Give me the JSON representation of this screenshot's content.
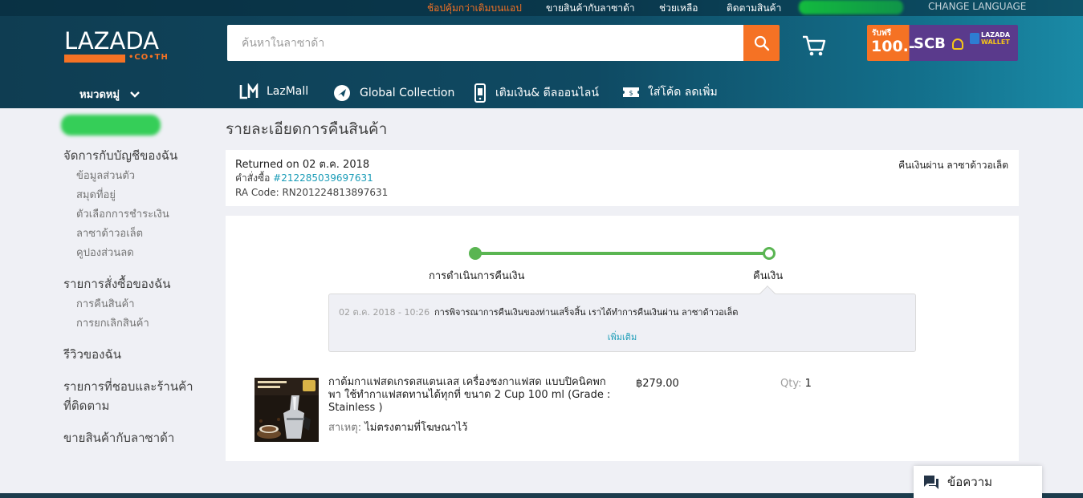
{
  "topbar": {
    "app_offer": "ช้อปคุ้มกว่าเดิมบนแอป",
    "sell": "ขายสินค้ากับลาซาด้า",
    "help": "ช่วยเหลือ",
    "track": "ติดตามสินค้า",
    "change_language": "CHANGE LANGUAGE"
  },
  "header": {
    "logo_word": "LAZADA",
    "logo_domain": "•CO•TH",
    "search_placeholder": "ค้นหาในลาซาด้า",
    "banner": {
      "line1": "รับฟรี",
      "amount": "100.-",
      "bank": "SCB",
      "wallet_line1": "LAZADA",
      "wallet_line2": "WALLET"
    }
  },
  "catnav": {
    "categories": "หมวดหมู่",
    "links": [
      "LazMall",
      "Global Collection",
      "เติมเงิน& ดีลออนไลน์",
      "ใส่โค้ด ลดเพิ่ม"
    ]
  },
  "sidebar": {
    "manage_account": "จัดการกับบัญชีของฉัน",
    "account_items": [
      "ข้อมูลส่วนตัว",
      "สมุดที่อยู่",
      "ตัวเลือกการชำระเงิน",
      "ลาซาด้าวอเล็ต",
      "คูปองส่วนลด"
    ],
    "my_orders": "รายการสั่งซื้อของฉัน",
    "order_items": [
      "การคืนสินค้า",
      "การยกเลิกสินค้า"
    ],
    "reviews": "รีวิวของฉัน",
    "wishlist_line1": "รายการที่ชอบและร้านค้า",
    "wishlist_line2": "ที่ติดตาม",
    "sell": "ขายสินค้ากับลาซาด้า"
  },
  "main": {
    "title": "รายละเอียดการคืนสินค้า",
    "returned_on": "Returned on 02 ต.ค. 2018",
    "order_label": "คำสั่งซื้อ",
    "order_number": "#212285039697631",
    "ra_code": "RA Code: RN201224813897631",
    "refund_via": "คืนเงินผ่าน ลาซาด้าวอเล็ต",
    "steps": [
      "การดำเนินการคืนเงิน",
      "คืนเงิน"
    ],
    "detail_time": "02 ต.ค. 2018 - 10:26",
    "detail_message": "การพิจารณาการคืนเงินของท่านเสร็จสิ้น เราได้ทำการคืนเงินผ่าน ลาซาด้าวอเล็ต",
    "more": "เพิ่มเติม",
    "product": {
      "name": "กาต้มกาแฟสดเกรดสแตนเลส เครื่องชงกาแฟสด แบบปิคนิคพกพา ใช้ทำกาแฟสดทานได้ทุกที่ ขนาด 2 Cup 100 ml (Grade : Stainless )",
      "reason_label": "สาเหตุ:",
      "reason": "ไม่ตรงตามที่โฆษณาไว้",
      "price": "฿279.00",
      "qty_label": "Qty:",
      "qty": "1"
    }
  },
  "chat": {
    "label": "ข้อความ"
  },
  "colors": {
    "accent": "#f57224",
    "progress": "#5ab552",
    "link": "#1a9cb7",
    "header": "#0f4a63"
  }
}
